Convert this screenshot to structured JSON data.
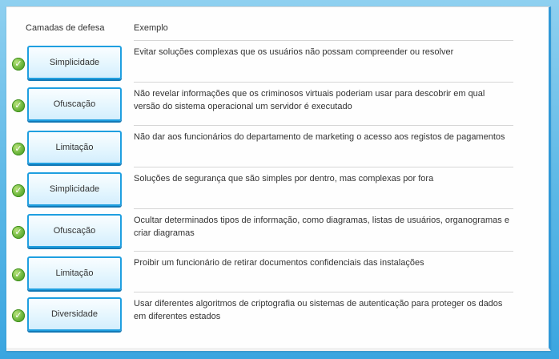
{
  "header": {
    "col1": "Camadas de defesa",
    "col2": "Exemplo"
  },
  "rows": [
    {
      "status": "correct",
      "button_label": "Simplicidade",
      "example": "Evitar soluções complexas que os usuários não possam compreender ou resolver"
    },
    {
      "status": "correct",
      "button_label": "Ofuscação",
      "example": "Não revelar informações que os criminosos virtuais poderiam usar para descobrir em qual versão do sistema operacional um servidor é executado"
    },
    {
      "status": "correct",
      "button_label": "Limitação",
      "example": "Não dar aos funcionários do departamento de marketing o acesso aos registos de pagamentos"
    },
    {
      "status": "correct",
      "button_label": "Simplicidade",
      "example": "Soluções de segurança que são simples por dentro, mas complexas por fora"
    },
    {
      "status": "correct",
      "button_label": "Ofuscação",
      "example": "Ocultar determinados tipos de informação, como diagramas, listas de usuários, organogramas e criar diagramas"
    },
    {
      "status": "correct",
      "button_label": "Limitação",
      "example": "Proibir um funcionário de retirar documentos confidenciais das instalações"
    },
    {
      "status": "correct",
      "button_label": "Diversidade",
      "example": "Usar diferentes algoritmos de criptografia ou sistemas de autenticação para proteger os dados em diferentes estados"
    }
  ],
  "icons": {
    "status": "check-circle-icon"
  },
  "colors": {
    "button_border": "#1f9fe0",
    "button_fill": "#e5f6fe",
    "check_green": "#6bb53b",
    "background_blue": "#5ab7e6"
  }
}
